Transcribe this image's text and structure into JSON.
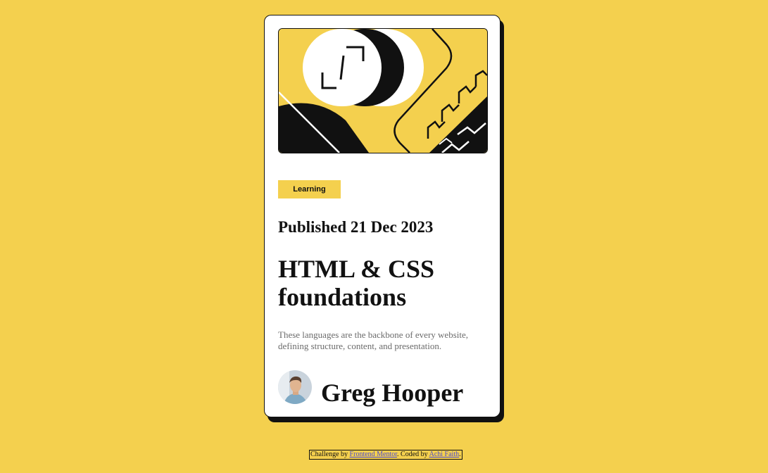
{
  "card": {
    "tag": "Learning",
    "published": "Published 21 Dec 2023",
    "title": "HTML & CSS foundations",
    "description": "These languages are the backbone of every website, defining structure, content, and presentation.",
    "author": "Greg Hooper"
  },
  "attribution": {
    "prefix": "Challenge by",
    "challenge_link": "Frontend Mentor",
    "middle": ". Coded by",
    "coder_link": "Achi Faith",
    "suffix": "."
  },
  "colors": {
    "background": "#f4d04e",
    "card": "#ffffff",
    "ink": "#111111",
    "muted": "#6b6b6b"
  },
  "icons": {
    "hero": "code-illustration",
    "avatar": "person-avatar"
  }
}
